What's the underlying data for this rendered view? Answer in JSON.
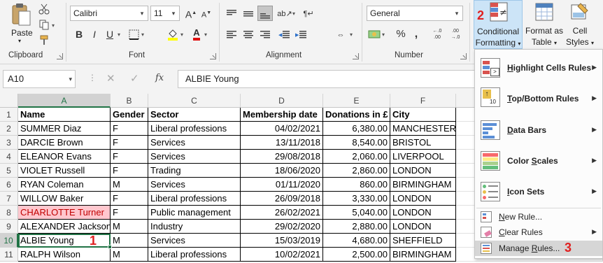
{
  "ribbon": {
    "clipboard": {
      "paste_label": "Paste",
      "group_label": "Clipboard"
    },
    "font": {
      "font_name": "Calibri",
      "font_size": "11",
      "bold": "B",
      "italic": "I",
      "underline": "U",
      "grow": "A",
      "shrink": "A",
      "font_color_letter": "A",
      "group_label": "Font"
    },
    "alignment": {
      "group_label": "Alignment"
    },
    "number": {
      "format": "General",
      "percent": "%",
      "comma": ",",
      "group_label": "Number"
    },
    "styles": {
      "cf_line1": "Conditional",
      "cf_line2": "Formatting",
      "fat_line1": "Format as",
      "fat_line2": "Table",
      "cs_line1": "Cell",
      "cs_line2": "Styles"
    }
  },
  "formula_bar": {
    "name_box": "A10",
    "fx": "fx",
    "formula": "ALBIE Young"
  },
  "grid": {
    "columns": [
      "A",
      "B",
      "C",
      "D",
      "E",
      "F"
    ],
    "rows": [
      "1",
      "2",
      "3",
      "4",
      "5",
      "6",
      "7",
      "8",
      "9",
      "10",
      "11"
    ],
    "headers": [
      "Name",
      "Gender",
      "Sector",
      "Membership date",
      "Donations in £",
      "City"
    ],
    "data": [
      [
        "SUMMER Diaz",
        "F",
        "Liberal professions",
        "04/02/2021",
        "6,380.00",
        "MANCHESTER"
      ],
      [
        "DARCIE Brown",
        "F",
        "Services",
        "13/11/2018",
        "8,540.00",
        "BRISTOL"
      ],
      [
        "ELEANOR Evans",
        "F",
        "Services",
        "29/08/2018",
        "2,060.00",
        "LIVERPOOL"
      ],
      [
        "VIOLET Russell",
        "F",
        "Trading",
        "18/06/2020",
        "2,860.00",
        "LONDON"
      ],
      [
        "RYAN Coleman",
        "M",
        "Services",
        "01/11/2020",
        "860.00",
        "BIRMINGHAM"
      ],
      [
        "WILLOW Baker",
        "F",
        "Liberal professions",
        "26/09/2018",
        "3,330.00",
        "LONDON"
      ],
      [
        "CHARLOTTE Turner",
        "F",
        "Public management",
        "26/02/2021",
        "5,040.00",
        "LONDON"
      ],
      [
        "ALEXANDER Jackson",
        "M",
        "Industry",
        "29/02/2020",
        "2,880.00",
        "LONDON"
      ],
      [
        "ALBIE Young",
        "M",
        "Services",
        "15/03/2019",
        "4,680.00",
        "SHEFFIELD"
      ],
      [
        "RALPH Wilson",
        "M",
        "Liberal professions",
        "10/02/2021",
        "2,500.00",
        "BIRMINGHAM"
      ]
    ]
  },
  "steps": {
    "one": "1",
    "two": "2",
    "three": "3"
  },
  "menu": {
    "highlight": {
      "pre": "",
      "acc": "H",
      "post": "ighlight Cells Rules"
    },
    "topbottom": {
      "pre": "",
      "acc": "T",
      "post": "op/Bottom Rules"
    },
    "databars": {
      "pre": "",
      "acc": "D",
      "post": "ata Bars"
    },
    "colorscales": {
      "pre": "Color ",
      "acc": "S",
      "post": "cales"
    },
    "iconsets": {
      "pre": "",
      "acc": "I",
      "post": "con Sets"
    },
    "newrule": {
      "pre": "",
      "acc": "N",
      "post": "ew Rule..."
    },
    "clearrules": {
      "pre": "",
      "acc": "C",
      "post": "lear Rules"
    },
    "managerules": {
      "pre": "Manage ",
      "acc": "R",
      "post": "ules..."
    }
  },
  "colors": {
    "excel_green": "#217346",
    "highlight_fill": "#ffc7ce",
    "highlight_text": "#c00000",
    "step_red": "#e02020",
    "cf_selected": "#cce4f7"
  }
}
